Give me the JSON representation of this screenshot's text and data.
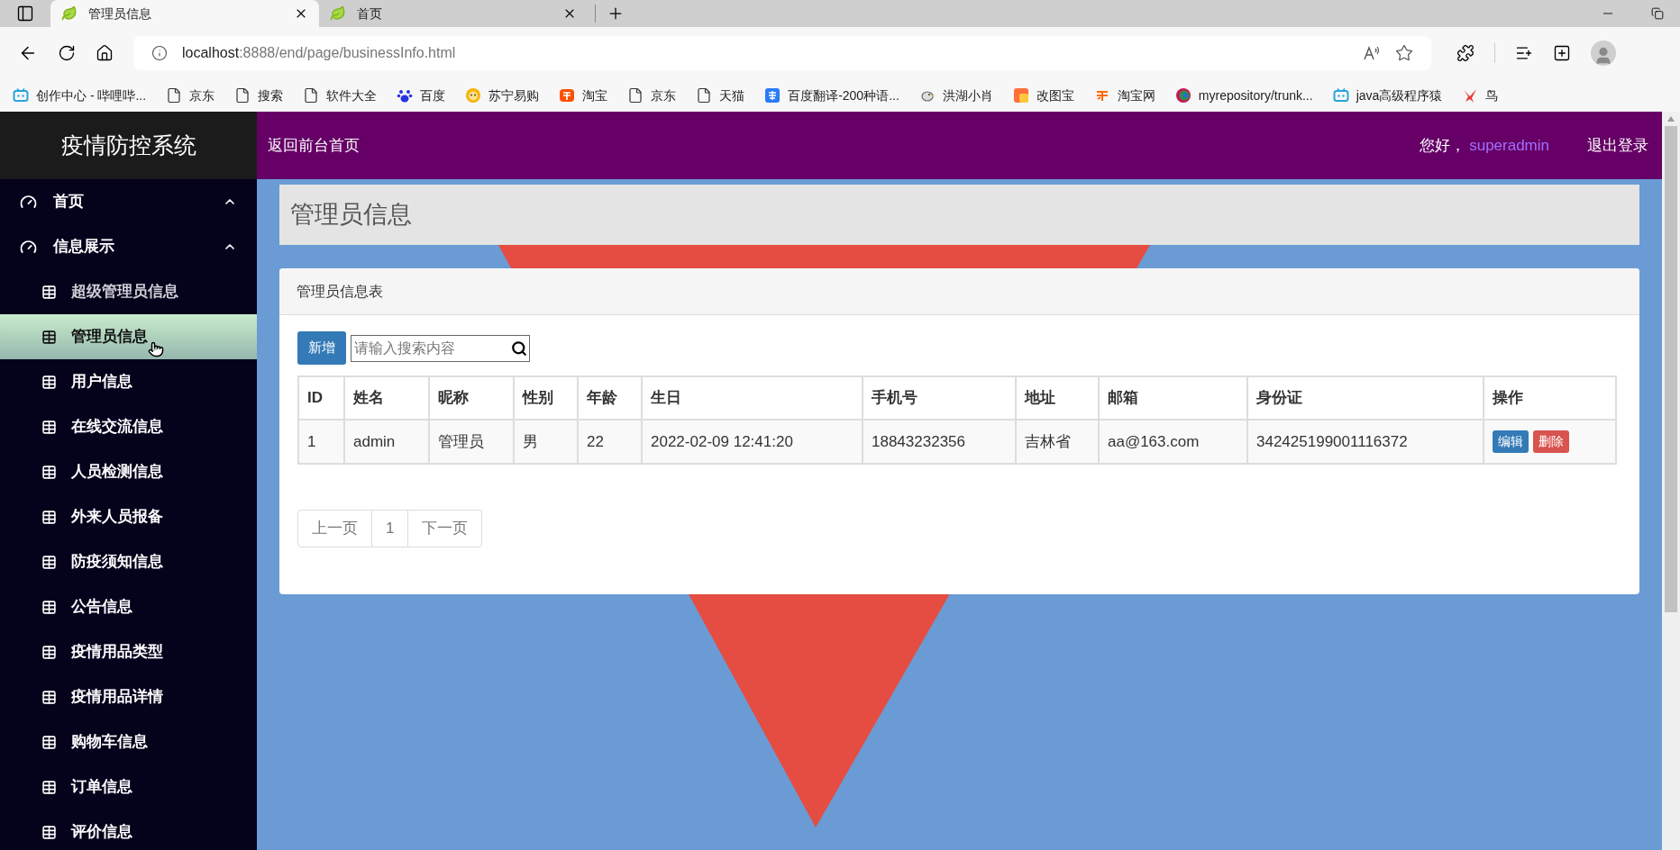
{
  "browser": {
    "tabs": [
      {
        "title": "管理员信息",
        "selected": true
      },
      {
        "title": "首页",
        "selected": false
      }
    ],
    "url": {
      "host": "localhost",
      "rest": ":8888/end/page/businessInfo.html"
    },
    "bookmarks": [
      {
        "label": "创作中心 - 哔哩哔...",
        "kind": "tv"
      },
      {
        "label": "京东",
        "kind": "page"
      },
      {
        "label": "搜索",
        "kind": "page"
      },
      {
        "label": "软件大全",
        "kind": "page"
      },
      {
        "label": "百度",
        "kind": "paw"
      },
      {
        "label": "苏宁易购",
        "kind": "sun"
      },
      {
        "label": "淘宝",
        "kind": "tao"
      },
      {
        "label": "京东",
        "kind": "page"
      },
      {
        "label": "天猫",
        "kind": "page"
      },
      {
        "label": "百度翻译-200种语...",
        "kind": "translate"
      },
      {
        "label": "洪湖小肖",
        "kind": "bird"
      },
      {
        "label": "改图宝",
        "kind": "square"
      },
      {
        "label": "淘宝网",
        "kind": "tao2"
      },
      {
        "label": "myrepository/trunk...",
        "kind": "swirl"
      },
      {
        "label": "java高级程序猿",
        "kind": "tv"
      },
      {
        "label": "鸟",
        "kind": "swallow"
      }
    ]
  },
  "sidebar": {
    "title": "疫情防控系统",
    "groups": [
      {
        "label": "首页",
        "expanded": true
      },
      {
        "label": "信息展示",
        "expanded": true,
        "children": [
          {
            "label": "超级管理员信息",
            "selected": false
          },
          {
            "label": "管理员信息",
            "selected": true
          },
          {
            "label": "用户信息",
            "selected": false
          },
          {
            "label": "在线交流信息",
            "selected": false
          },
          {
            "label": "人员检测信息",
            "selected": false
          },
          {
            "label": "外来人员报备",
            "selected": false
          },
          {
            "label": "防疫须知信息",
            "selected": false
          },
          {
            "label": "公告信息",
            "selected": false
          },
          {
            "label": "疫情用品类型",
            "selected": false
          },
          {
            "label": "疫情用品详情",
            "selected": false
          },
          {
            "label": "购物车信息",
            "selected": false
          },
          {
            "label": "订单信息",
            "selected": false
          },
          {
            "label": "评价信息",
            "selected": false
          }
        ]
      }
    ]
  },
  "header": {
    "home_link": "返回前台首页",
    "greeting": "您好，",
    "user": "superadmin",
    "logout": "退出登录"
  },
  "page_title": "管理员信息",
  "card": {
    "title": "管理员信息表",
    "add_button": "新增",
    "search": {
      "placeholder": "请输入搜索内容"
    },
    "table": {
      "columns": [
        "ID",
        "姓名",
        "昵称",
        "性别",
        "年龄",
        "生日",
        "手机号",
        "地址",
        "邮箱",
        "身份证",
        "操作"
      ],
      "rows": [
        {
          "cells": [
            "1",
            "admin",
            "管理员",
            "男",
            "22",
            "2022-02-09 12:41:20",
            "18843232356",
            "吉林省",
            "aa@163.com",
            "342425199001116372"
          ],
          "actions": [
            {
              "label": "编辑",
              "kind": "edit"
            },
            {
              "label": "删除",
              "kind": "delete"
            }
          ]
        }
      ]
    },
    "pagination": {
      "prev": "上一页",
      "pages": [
        "1"
      ],
      "next": "下一页"
    }
  }
}
